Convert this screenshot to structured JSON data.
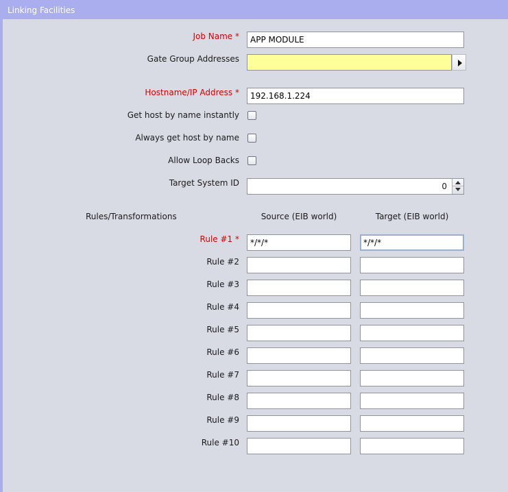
{
  "panel": {
    "title": "Linking Facilities"
  },
  "job": {
    "label": "Job Name *",
    "value": "APP MODULE"
  },
  "gate_group": {
    "label": "Gate Group Addresses",
    "value": ""
  },
  "hostname": {
    "label": "Hostname/IP Address *",
    "value": "192.168.1.224"
  },
  "options": {
    "get_host_instantly": {
      "label": "Get host by name instantly",
      "checked": false
    },
    "always_get_host": {
      "label": "Always get host by name",
      "checked": false
    },
    "allow_loop_backs": {
      "label": "Allow Loop Backs",
      "checked": false
    }
  },
  "target_system": {
    "label": "Target System ID",
    "value": "0"
  },
  "rules": {
    "section_label": "Rules/Transformations",
    "source_header": "Source (EIB world)",
    "target_header": "Target (EIB world)",
    "items": [
      {
        "label": "Rule #1 *",
        "source": "*/*/*",
        "target": "*/*/*"
      },
      {
        "label": "Rule #2",
        "source": "",
        "target": ""
      },
      {
        "label": "Rule #3",
        "source": "",
        "target": ""
      },
      {
        "label": "Rule #4",
        "source": "",
        "target": ""
      },
      {
        "label": "Rule #5",
        "source": "",
        "target": ""
      },
      {
        "label": "Rule #6",
        "source": "",
        "target": ""
      },
      {
        "label": "Rule #7",
        "source": "",
        "target": ""
      },
      {
        "label": "Rule #8",
        "source": "",
        "target": ""
      },
      {
        "label": "Rule #9",
        "source": "",
        "target": ""
      },
      {
        "label": "Rule #10",
        "source": "",
        "target": ""
      }
    ]
  },
  "colors": {
    "title_bar": "#aaaeee",
    "required_label": "#d40000",
    "highlight_field": "#ffff9a",
    "background": "#d8dbe3"
  }
}
